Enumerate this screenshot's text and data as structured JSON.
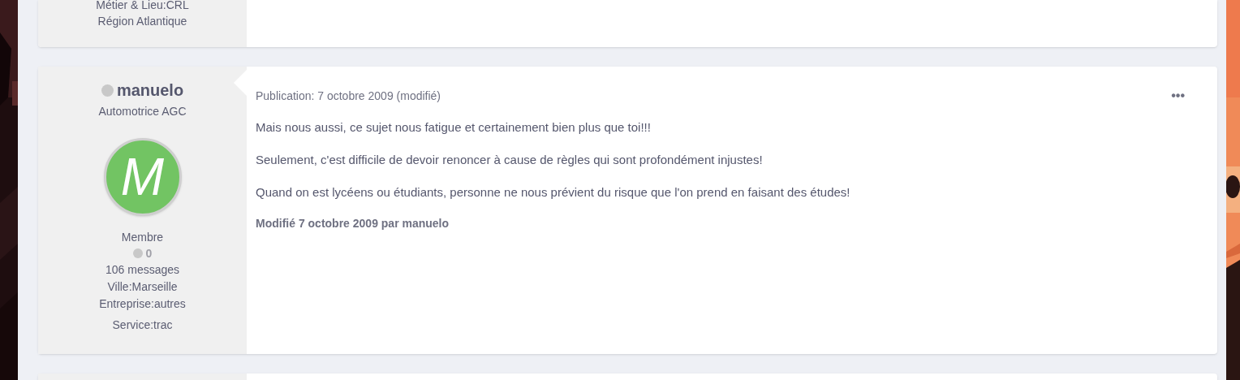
{
  "previous_post": {
    "author_fields": [
      "Métier & Lieu:CRL Région Atlantique"
    ]
  },
  "post": {
    "author": {
      "name": "manuelo",
      "online": false,
      "title": "Automotrice AGC",
      "avatar_letter": "M",
      "group": "Membre",
      "reputation": "0",
      "fields": [
        "106 messages",
        "Ville:Marseille",
        "Entreprise:autres",
        "Service:trac"
      ]
    },
    "published": "Publication: 7 octobre 2009 (modifié)",
    "menu": "•••",
    "paragraphs": [
      "Mais nous aussi, ce sujet nous fatigue et certainement bien plus que toi!!!",
      "Seulement, c'est difficile de devoir renoncer à cause de règles qui sont profondément injustes!",
      "Quand on est lycéens ou étudiants, personne ne nous prévient du risque que l'on prend en faisant des études!"
    ],
    "edited": "Modifié 7 octobre 2009 par manuelo"
  }
}
